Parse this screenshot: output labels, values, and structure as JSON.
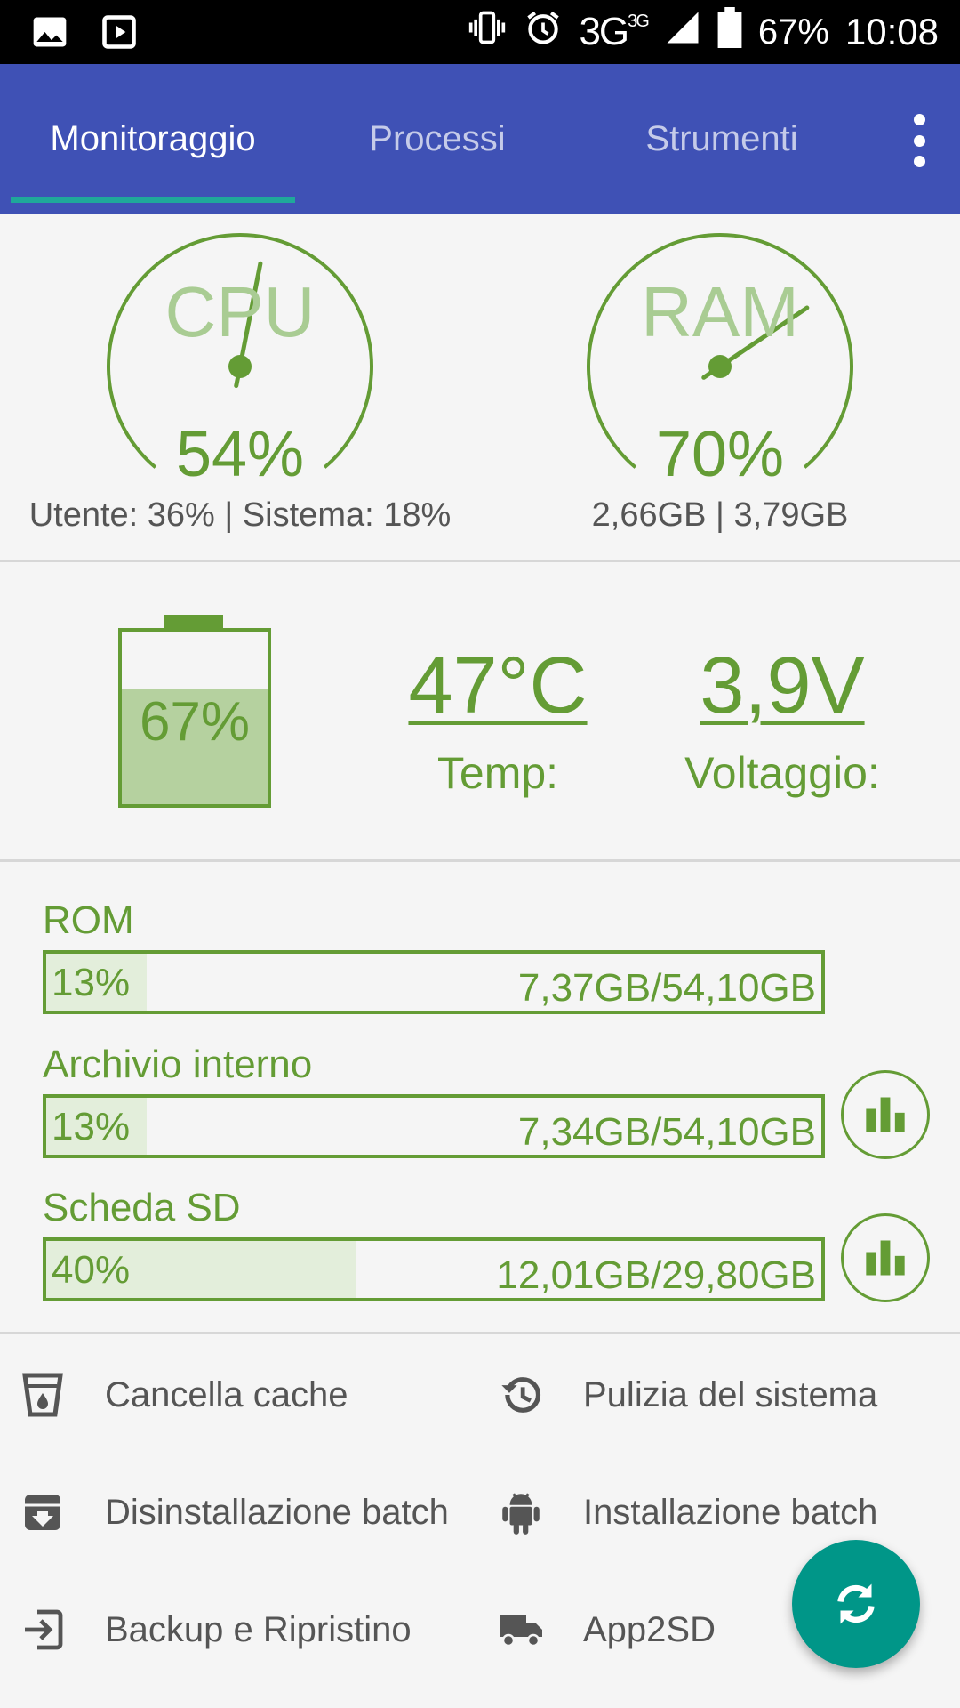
{
  "status_bar": {
    "network": "3G",
    "network_sup": "3G",
    "battery": "67%",
    "time": "10:08"
  },
  "tabs": [
    {
      "label": "Monitoraggio",
      "active": true
    },
    {
      "label": "Processi",
      "active": false
    },
    {
      "label": "Strumenti",
      "active": false
    }
  ],
  "cpu": {
    "label": "CPU",
    "percent": "54%",
    "value": 54,
    "detail": "Utente: 36% | Sistema: 18%"
  },
  "ram": {
    "label": "RAM",
    "percent": "70%",
    "value": 70,
    "detail": "2,66GB | 3,79GB"
  },
  "battery": {
    "percent": "67%",
    "level": 0.67,
    "temp_value": "47°C",
    "temp_label": "Temp:",
    "voltage_value": "3,9V",
    "voltage_label": "Voltaggio:"
  },
  "storage": [
    {
      "label": "ROM",
      "percent": "13%",
      "fraction": 0.13,
      "size": "7,37GB/54,10GB",
      "has_button": false
    },
    {
      "label": "Archivio interno",
      "percent": "13%",
      "fraction": 0.13,
      "size": "7,34GB/54,10GB",
      "has_button": true
    },
    {
      "label": "Scheda SD",
      "percent": "40%",
      "fraction": 0.4,
      "size": "12,01GB/29,80GB",
      "has_button": true
    }
  ],
  "tools": [
    {
      "label": "Cancella cache",
      "icon": "cache-icon"
    },
    {
      "label": "Pulizia del sistema",
      "icon": "history-icon"
    },
    {
      "label": "Disinstallazione batch",
      "icon": "archive-icon"
    },
    {
      "label": "Installazione batch",
      "icon": "android-icon"
    },
    {
      "label": "Backup e Ripristino",
      "icon": "import-icon"
    },
    {
      "label": "App2SD",
      "icon": "truck-icon"
    }
  ],
  "colors": {
    "primary": "#3f51b5",
    "accent": "#649c35",
    "fab": "#009688",
    "indicator": "#1fa89a"
  }
}
